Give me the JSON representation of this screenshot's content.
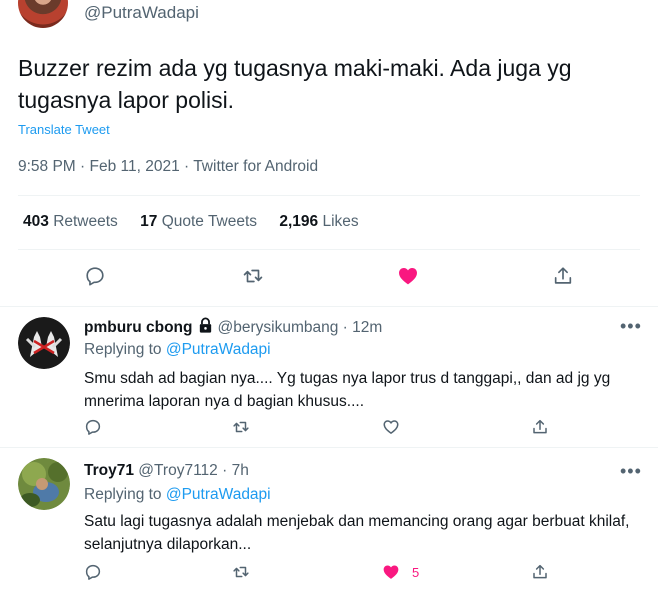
{
  "main": {
    "handle": "@PutraWadapi",
    "text": "Buzzer rezim ada yg tugasnya maki-maki. Ada juga yg tugasnya lapor polisi.",
    "translate_label": "Translate Tweet",
    "meta": "9:58 PM · Feb 11, 2021 · Twitter for Android",
    "stats": {
      "retweets_count": "403",
      "retweets_label": "Retweets",
      "quotes_count": "17",
      "quotes_label": "Quote Tweets",
      "likes_count": "2,196",
      "likes_label": "Likes"
    },
    "liked": true
  },
  "replies": [
    {
      "name": "pmburu cbong",
      "handle": "@berysikumbang",
      "time": "12m",
      "replying_prefix": "Replying to",
      "replying_to": "@PutraWadapi",
      "text": "Smu sdah ad bagian nya.... Yg tugas nya lapor trus d tanggapi,, dan ad jg yg mnerima laporan nya d bagian khusus....",
      "liked": false,
      "like_count": "",
      "avatar": "hands-icon"
    },
    {
      "name": "Troy71",
      "handle": "@Troy7112",
      "time": "7h",
      "replying_prefix": "Replying to",
      "replying_to": "@PutraWadapi",
      "text": "Satu lagi tugasnya adalah menjebak dan memancing orang agar berbuat khilaf, selanjutnya dilaporkan...",
      "liked": true,
      "like_count": "5",
      "avatar": "photo-avatar"
    }
  ],
  "colors": {
    "like_active": "#f91880",
    "link": "#1d9bf0",
    "secondary_text": "#536471",
    "divider": "#eff3f4"
  }
}
